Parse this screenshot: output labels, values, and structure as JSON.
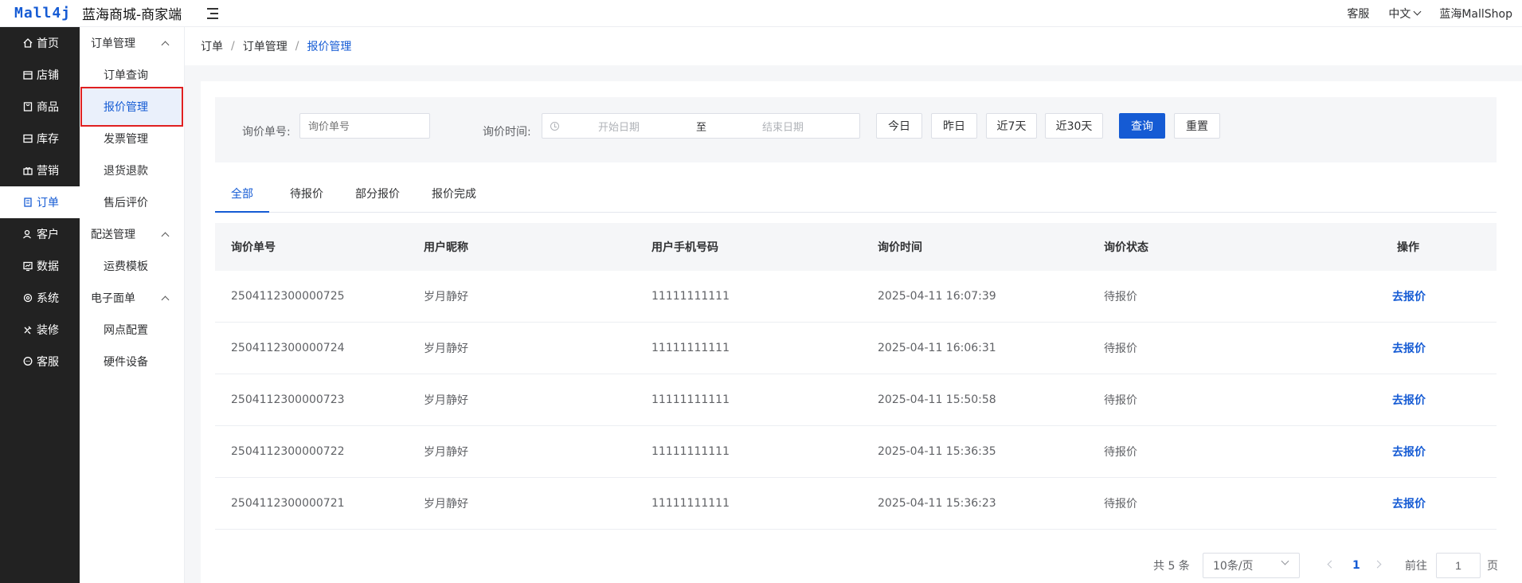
{
  "header": {
    "logo_mark": "Mall4j",
    "title": "蓝海商城-商家端",
    "customer_service": "客服",
    "language": "中文",
    "shop_name": "蓝海MallShop"
  },
  "sidebar": {
    "items": [
      {
        "label": "首页",
        "icon": "home-icon"
      },
      {
        "label": "店铺",
        "icon": "shop-icon"
      },
      {
        "label": "商品",
        "icon": "goods-icon"
      },
      {
        "label": "库存",
        "icon": "stock-icon"
      },
      {
        "label": "营销",
        "icon": "gift-icon"
      },
      {
        "label": "订单",
        "icon": "order-icon"
      },
      {
        "label": "客户",
        "icon": "customer-icon"
      },
      {
        "label": "数据",
        "icon": "data-icon"
      },
      {
        "label": "系统",
        "icon": "settings-icon"
      },
      {
        "label": "装修",
        "icon": "decorate-icon"
      },
      {
        "label": "客服",
        "icon": "chat-icon"
      }
    ],
    "active_index": 5
  },
  "subnav": {
    "group1": "订单管理",
    "g1_items": [
      "订单查询",
      "报价管理",
      "发票管理",
      "退货退款",
      "售后评价"
    ],
    "group2": "配送管理",
    "g2_items": [
      "运费模板"
    ],
    "group3": "电子面单",
    "g3_items": [
      "网点配置",
      "硬件设备"
    ]
  },
  "breadcrumb": [
    "订单",
    "订单管理",
    "报价管理"
  ],
  "filter": {
    "order_label": "询价单号:",
    "order_placeholder": "询价单号",
    "time_label": "询价时间:",
    "start_placeholder": "开始日期",
    "range_sep": "至",
    "end_placeholder": "结束日期",
    "quick": [
      "今日",
      "昨日",
      "近7天",
      "近30天"
    ],
    "search": "查询",
    "reset": "重置"
  },
  "tabs": [
    "全部",
    "待报价",
    "部分报价",
    "报价完成"
  ],
  "table": {
    "columns": [
      "询价单号",
      "用户昵称",
      "用户手机号码",
      "询价时间",
      "询价状态",
      "操作"
    ],
    "rows": [
      {
        "id": "2504112300000725",
        "nick": "岁月静好",
        "phone": "11111111111",
        "time": "2025-04-11 16:07:39",
        "status": "待报价",
        "action": "去报价"
      },
      {
        "id": "2504112300000724",
        "nick": "岁月静好",
        "phone": "11111111111",
        "time": "2025-04-11 16:06:31",
        "status": "待报价",
        "action": "去报价"
      },
      {
        "id": "2504112300000723",
        "nick": "岁月静好",
        "phone": "11111111111",
        "time": "2025-04-11 15:50:58",
        "status": "待报价",
        "action": "去报价"
      },
      {
        "id": "2504112300000722",
        "nick": "岁月静好",
        "phone": "11111111111",
        "time": "2025-04-11 15:36:35",
        "status": "待报价",
        "action": "去报价"
      },
      {
        "id": "2504112300000721",
        "nick": "岁月静好",
        "phone": "11111111111",
        "time": "2025-04-11 15:36:23",
        "status": "待报价",
        "action": "去报价"
      }
    ]
  },
  "pagination": {
    "total": "共 5 条",
    "page_size": "10条/页",
    "current": "1",
    "goto_label": "前往",
    "goto_value": "1",
    "page_unit": "页"
  },
  "colors": {
    "accent": "#155bd4",
    "sidebar_bg": "#222222",
    "highlight_border": "#e02020"
  }
}
